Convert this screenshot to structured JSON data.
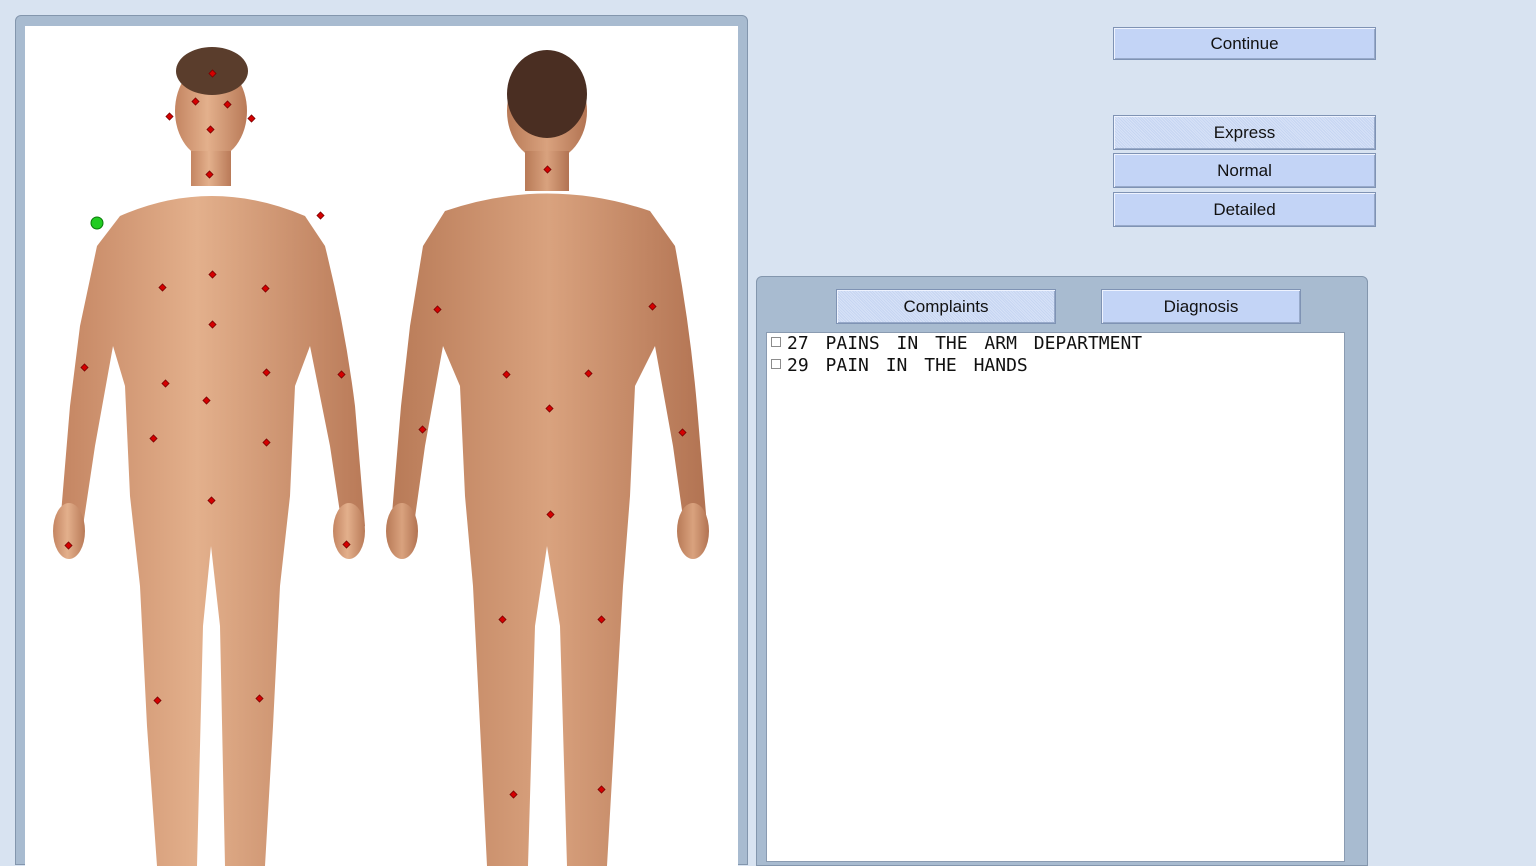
{
  "buttons": {
    "continue": "Continue",
    "express": "Express",
    "normal": "Normal",
    "detailed": "Detailed"
  },
  "tabs": {
    "complaints": "Complaints",
    "diagnosis": "Diagnosis"
  },
  "complaints": [
    {
      "code": "27",
      "text": "PAINS IN THE ARM DEPARTMENT",
      "checked": false
    },
    {
      "code": "29",
      "text": "PAIN IN THE HANDS",
      "checked": false
    }
  ],
  "colors": {
    "skin": "#d8a07c",
    "point": "#d40000",
    "selected_point": "#22cc22",
    "hair": "#5a3d2c"
  }
}
